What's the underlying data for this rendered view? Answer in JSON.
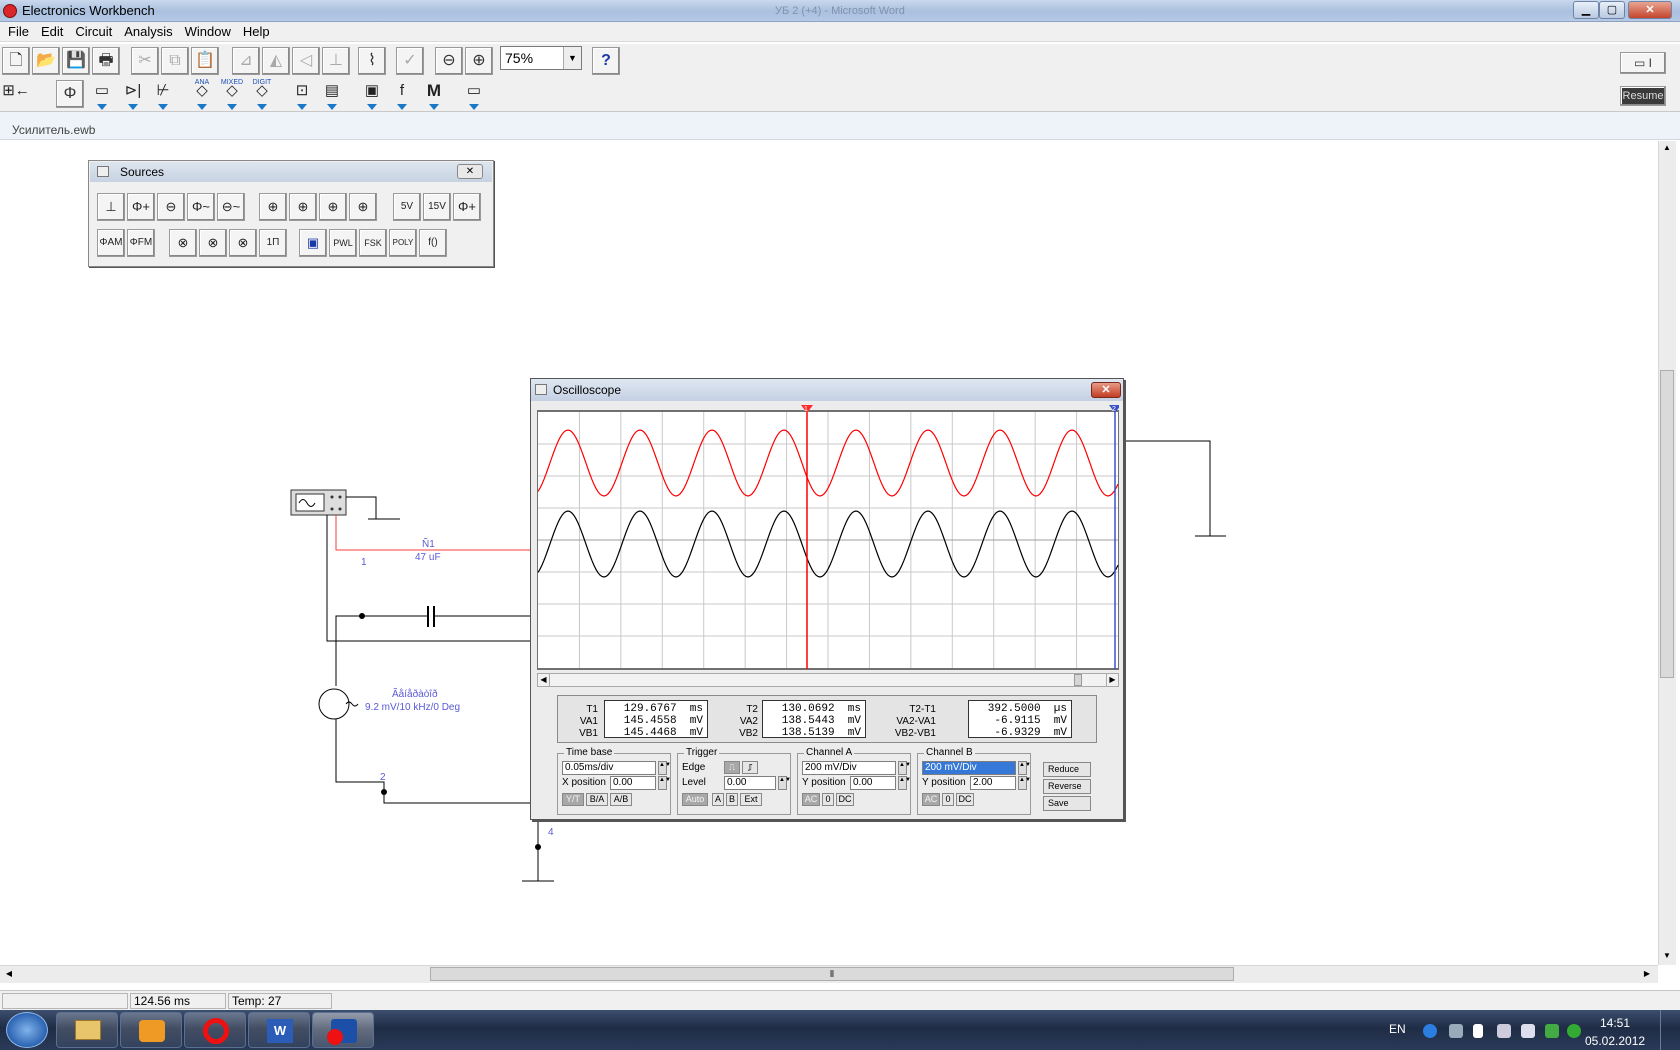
{
  "window": {
    "title": "Electronics Workbench",
    "background_title": "УБ 2 (+4)  -  Microsoft Word",
    "min": "▁",
    "max": "▢",
    "close": "✕"
  },
  "menu": [
    "File",
    "Edit",
    "Circuit",
    "Analysis",
    "Window",
    "Help"
  ],
  "toolbar": {
    "zoom": "75%",
    "help": "?",
    "resume": "Resume",
    "analog_cap": "ANA",
    "mixed_cap": "MIXED",
    "digital_cap": "DIGIT",
    "misc_cap": "M"
  },
  "document": {
    "name": "Усилитель.ewb"
  },
  "sources": {
    "title": "Sources",
    "row1": [
      "⊥",
      "Φ+",
      "⊖",
      "Φ~",
      "⊖~",
      "⊕",
      "⊕",
      "⊕",
      "⊕",
      "5V",
      "15V",
      "Φ+"
    ],
    "row2": [
      "ΦAM",
      "ΦFM",
      "⊗",
      "⊗",
      "⊗",
      "1Π",
      "▣",
      "PWL",
      "FSK",
      "POLY",
      "f()"
    ]
  },
  "circuit": {
    "cap_label": "Ñ1",
    "cap_value": "47 uF",
    "source_label": "Ãåíåðàòîð",
    "source_value": "9.2 mV/10 kHz/0 Deg",
    "node1": "1",
    "node2": "2",
    "node4": "4"
  },
  "oscilloscope": {
    "title": "Oscilloscope",
    "close": "✕",
    "readout": {
      "t1_label": "T1",
      "va1_label": "VA1",
      "vb1_label": "VB1",
      "t1": "129.6767  ms",
      "va1": "145.4558  mV",
      "vb1": "145.4468  mV",
      "t2_label": "T2",
      "va2_label": "VA2",
      "vb2_label": "VB2",
      "t2": "130.0692  ms",
      "va2": "138.5443  mV",
      "vb2": "138.5139  mV",
      "dt_label": "T2-T1",
      "dva_label": "VA2-VA1",
      "dvb_label": "VB2-VB1",
      "dt": "392.5000  µs",
      "dva": "-6.9115  mV",
      "dvb": "-6.9329  mV"
    },
    "timebase": {
      "label": "Time base",
      "value": "0.05ms/div",
      "xpos_label": "X position",
      "xpos": "0.00",
      "yt": "Y/T",
      "ba": "B/A",
      "ab": "A/B"
    },
    "trigger": {
      "label": "Trigger",
      "edge_label": "Edge",
      "level_label": "Level",
      "level": "0.00",
      "auto": "Auto",
      "a": "A",
      "b": "B",
      "ext": "Ext"
    },
    "channel_a": {
      "label": "Channel A",
      "value": "200 mV/Div",
      "ypos_label": "Y position",
      "ypos": "0.00",
      "ac": "AC",
      "zero": "0",
      "dc": "DC"
    },
    "channel_b": {
      "label": "Channel B",
      "value": "200 mV/Div",
      "ypos_label": "Y position",
      "ypos": "2.00",
      "ac": "AC",
      "zero": "0",
      "dc": "DC"
    },
    "buttons": {
      "reduce": "Reduce",
      "reverse": "Reverse",
      "save": "Save"
    },
    "trace_colors": {
      "channel_a": "#000000",
      "channel_b": "#ff0000"
    },
    "cursor_1": "1",
    "cursor_2": "2"
  },
  "status": {
    "time": "124.56 ms",
    "temp": "Temp:  27"
  },
  "taskbar": {
    "lang": "EN",
    "time": "14:51",
    "date": "05.02.2012"
  }
}
